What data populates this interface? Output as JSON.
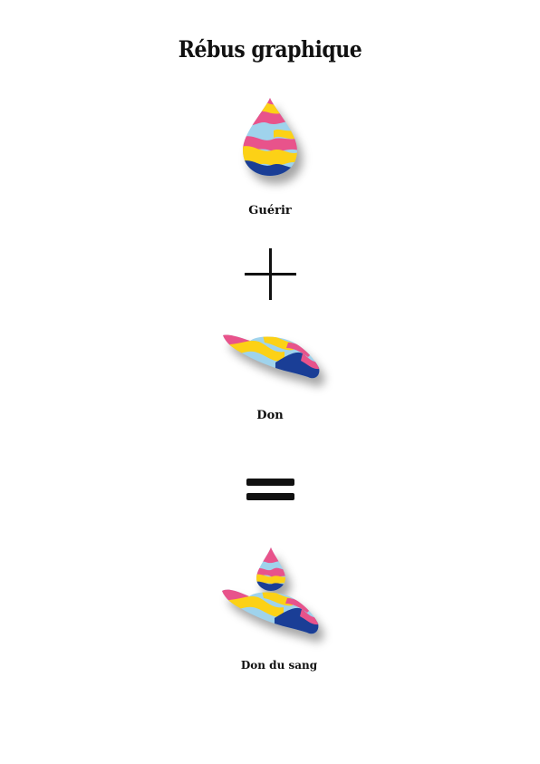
{
  "title": "Rébus graphique",
  "steps": [
    {
      "icon": "blood-drop-icon",
      "caption": "Guérir"
    },
    {
      "operator": "plus-sign"
    },
    {
      "icon": "open-hand-icon",
      "caption": "Don"
    },
    {
      "operator": "equals-sign"
    },
    {
      "icon": "hand-with-drop-icon",
      "caption": "Don du sang"
    }
  ],
  "colors": {
    "pink": "#e8538b",
    "light_blue": "#9fd3ec",
    "yellow": "#fcd116",
    "blue": "#1a3e96",
    "ink": "#111111"
  }
}
